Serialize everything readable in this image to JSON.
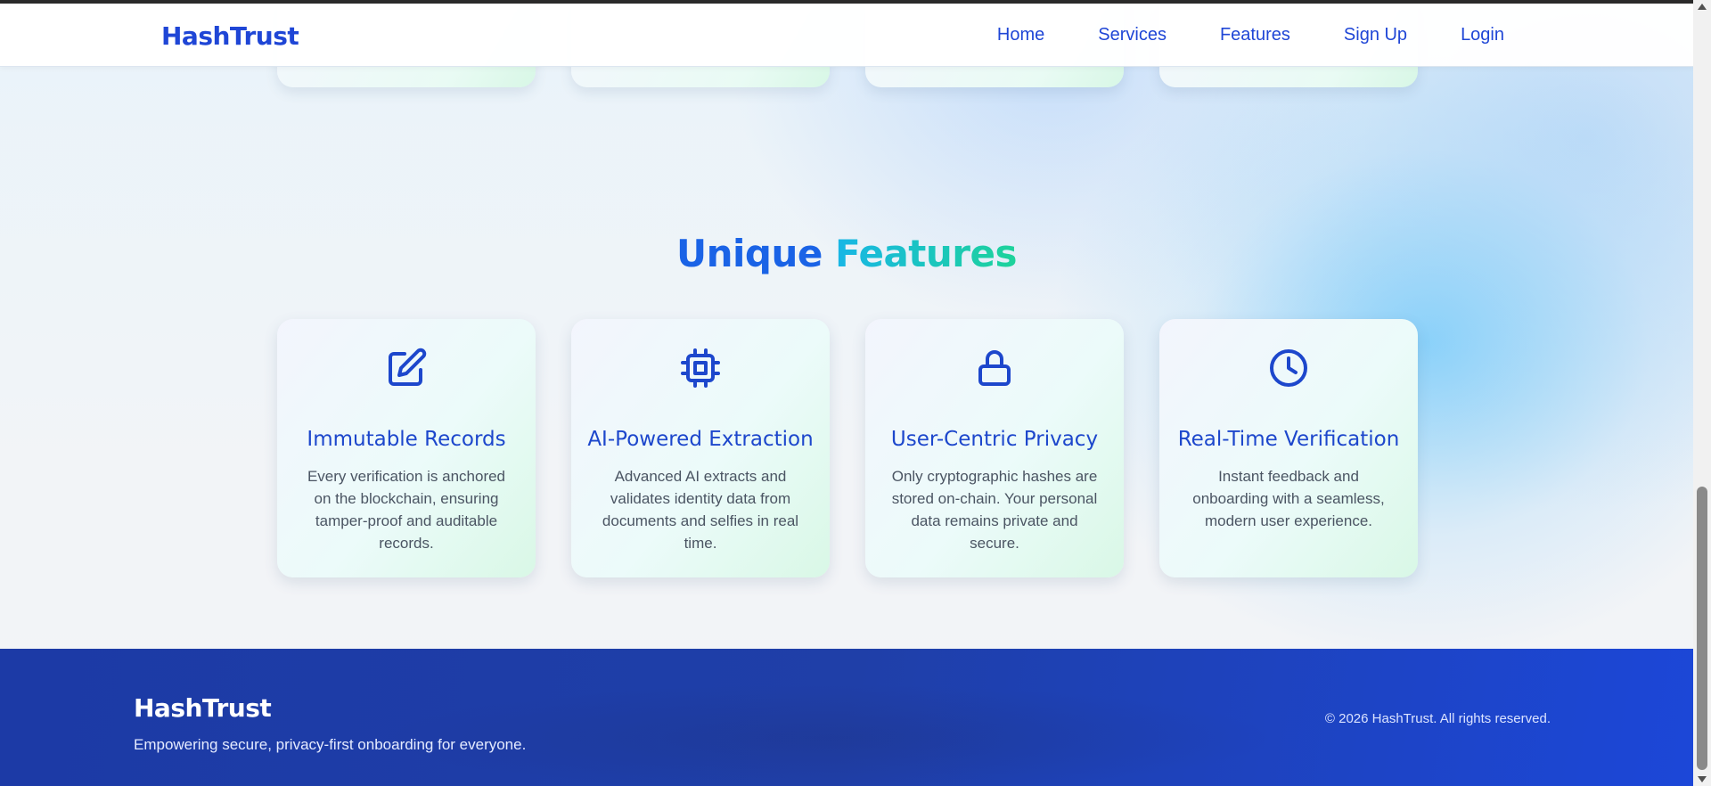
{
  "nav": {
    "brand": "HashTrust",
    "links": [
      "Home",
      "Services",
      "Features",
      "Sign Up",
      "Login"
    ]
  },
  "features": {
    "title_part1": "Unique",
    "title_part2": "Features",
    "accent_colors": [
      "#1a63e6",
      "#18b6e6",
      "#1dd39a"
    ],
    "cards": [
      {
        "icon": "edit-icon",
        "title": "Immutable Records",
        "description": "Every verification is anchored on the blockchain, ensuring tamper-proof and auditable records."
      },
      {
        "icon": "cpu-chip-icon",
        "title": "AI-Powered Extraction",
        "description": "Advanced AI extracts and validates identity data from documents and selfies in real time."
      },
      {
        "icon": "lock-icon",
        "title": "User-Centric Privacy",
        "description": "Only cryptographic hashes are stored on-chain. Your personal data remains private and secure."
      },
      {
        "icon": "clock-icon",
        "title": "Real-Time Verification",
        "description": "Instant feedback and onboarding with a seamless, modern user experience."
      }
    ]
  },
  "footer": {
    "brand": "HashTrust",
    "tagline": "Empowering secure, privacy-first onboarding for everyone.",
    "copyright": "© 2026 HashTrust. All rights reserved."
  },
  "colors": {
    "primary": "#1f46d6",
    "footer_bg": "#1f3fa8",
    "card_title": "#1d47cc"
  }
}
